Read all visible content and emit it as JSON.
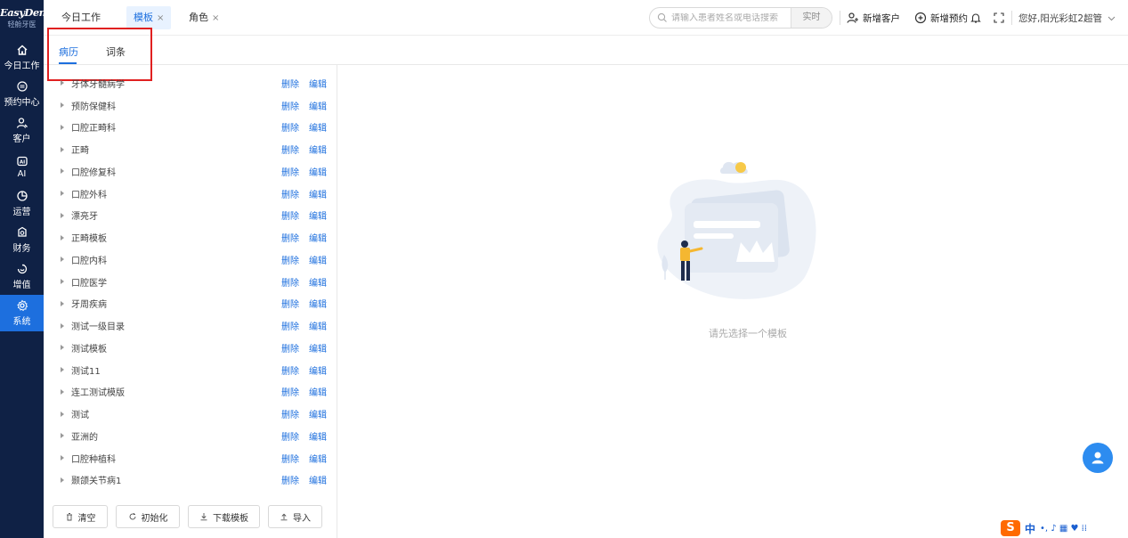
{
  "brand": {
    "logo": "EasyDent",
    "logo_sub": "轻舱牙医"
  },
  "sidebar": {
    "items": [
      {
        "label": "今日工作",
        "icon": "home-icon"
      },
      {
        "label": "预约中心",
        "icon": "calendar-icon"
      },
      {
        "label": "客户",
        "icon": "user-icon"
      },
      {
        "label": "AI",
        "icon": "ai-icon"
      },
      {
        "label": "运营",
        "icon": "pie-chart-icon"
      },
      {
        "label": "财务",
        "icon": "wallet-icon"
      },
      {
        "label": "增值",
        "icon": "gift-icon"
      },
      {
        "label": "系统",
        "icon": "gear-icon"
      }
    ],
    "active": "系统"
  },
  "header": {
    "tabs": [
      {
        "label": "今日工作",
        "closable": false
      },
      {
        "label": "模板",
        "closable": true
      },
      {
        "label": "角色",
        "closable": true
      }
    ],
    "close_glyph": "×",
    "search_placeholder": "请输入患者姓名或电话搜索",
    "search_button": "实时",
    "new_customer": "新增客户",
    "new_appointment": "新增预约",
    "greeting": "您好,阳光彩虹2超管"
  },
  "subtabs": {
    "items": [
      "病历",
      "词条"
    ],
    "active": "病历"
  },
  "templates": [
    "牙体牙髓病学",
    "预防保健科",
    "口腔正畸科",
    "正畸",
    "口腔修复科",
    "口腔外科",
    "漂亮牙",
    "正畸模板",
    "口腔内科",
    "口腔医学",
    "牙周疾病",
    "测试一级目录",
    "测试模板",
    "测试11",
    "连工测试模版",
    "测试",
    "亚洲的",
    "口腔种植科",
    "颞颌关节病1"
  ],
  "row_actions": {
    "delete": "删除",
    "edit": "编辑"
  },
  "buttons": {
    "clear": "清空",
    "init": "初始化",
    "download": "下载模板",
    "import": "导入"
  },
  "empty_state": "请先选择一个模板",
  "ime": {
    "logo": "S",
    "lang": "中",
    "extras": "•, ♪ ▦ ♥ ⁞⁞"
  },
  "colors": {
    "sidebar_bg": "#0f2145",
    "accent": "#1d6fde",
    "highlight": "#e02020"
  }
}
